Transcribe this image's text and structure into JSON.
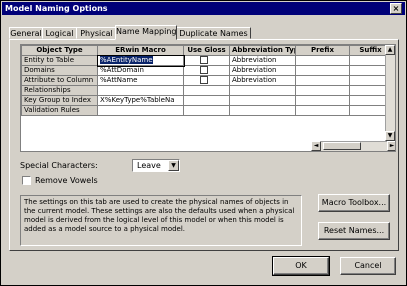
{
  "window": {
    "title": "Model Naming Options",
    "close_glyph": "×"
  },
  "tabs": [
    "General",
    "Logical",
    "Physical",
    "Name Mapping",
    "Duplicate Names"
  ],
  "active_tab": "Name Mapping",
  "grid": {
    "columns": [
      "Object Type",
      "ERwin Macro",
      "Use Gloss",
      "Abbreviation Typ",
      "Prefix",
      "Suffix"
    ],
    "rows": [
      {
        "type": "Entity to Table",
        "macro": "%AEntityName",
        "gloss": true,
        "abbrev": "Abbreviation",
        "prefix": "",
        "suffix": ""
      },
      {
        "type": "Domains",
        "macro": "%AttDomain",
        "gloss": true,
        "abbrev": "Abbreviation",
        "prefix": "",
        "suffix": ""
      },
      {
        "type": "Attribute to Column",
        "macro": "%AttName",
        "gloss": true,
        "abbrev": "Abbreviation",
        "prefix": "",
        "suffix": ""
      },
      {
        "type": "Relationships",
        "macro": "",
        "gloss": false,
        "abbrev": "",
        "prefix": "",
        "suffix": ""
      },
      {
        "type": "Key Group to Index",
        "macro": "X%KeyType%TableNa",
        "gloss": false,
        "abbrev": "",
        "prefix": "",
        "suffix": ""
      },
      {
        "type": "Validation Rules",
        "macro": "",
        "gloss": false,
        "abbrev": "",
        "prefix": "",
        "suffix": ""
      }
    ]
  },
  "special_characters": {
    "label": "Special Characters:",
    "value": "Leave"
  },
  "remove_vowels": {
    "label": "Remove Vowels",
    "checked": false
  },
  "info_text": "The settings on this tab are used to create the physical names of objects in the current model. These settings are also the defaults used when a physical model is derived from the logical level of this model or when this model is added as a model source to a physical model.",
  "buttons": {
    "macro_toolbox": "Macro Toolbox...",
    "reset_names": "Reset Names...",
    "ok": "OK",
    "cancel": "Cancel"
  }
}
